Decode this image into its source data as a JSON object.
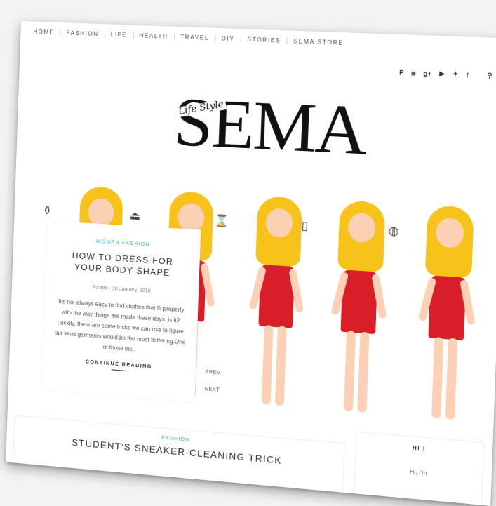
{
  "nav": [
    "HOME",
    "FASHION",
    "LIFE",
    "HEALTH",
    "TRAVEL",
    "DIY",
    "STORIES",
    "SEMA STORE"
  ],
  "social": [
    {
      "name": "pinterest-icon",
      "glyph": "P"
    },
    {
      "name": "instagram-icon",
      "glyph": "◙"
    },
    {
      "name": "google-plus-icon",
      "glyph": "g+"
    },
    {
      "name": "youtube-icon",
      "glyph": "▶"
    },
    {
      "name": "twitter-icon",
      "glyph": "✦"
    },
    {
      "name": "facebook-icon",
      "glyph": "f"
    },
    {
      "name": "search-icon",
      "glyph": "⚲"
    }
  ],
  "logo": {
    "main": "SEMA",
    "script": "Life Style"
  },
  "featured": {
    "category": "WOMEN FASHION",
    "title": "HOW TO DRESS FOR YOUR BODY SHAPE",
    "date": "Posted - 18 January, 2018",
    "excerpt": "It's not always easy to find clothes that fit properly with the way things are made these days, is it? Luckily, there are some tricks we can use to figure out what garments would be the most flattering.One of those tric..",
    "more": "CONTINUE READING"
  },
  "slider": {
    "prev": "PREV",
    "next": "NEXT"
  },
  "post2": {
    "category": "FASHION",
    "title": "STUDENT'S SNEAKER-CLEANING TRICK"
  },
  "widget": {
    "title": "HI !",
    "text": "Hi, I'm"
  },
  "colors": {
    "accent": "#2bbfb7",
    "dress": "#d81e28",
    "hair": "#f7c21a"
  }
}
